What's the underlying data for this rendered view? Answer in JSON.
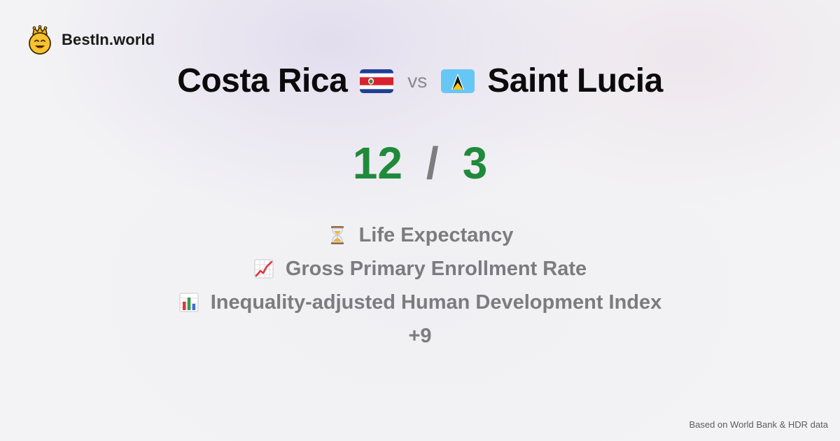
{
  "brand": {
    "name": "BestIn.world",
    "logo_icon": "crown-smiley-icon"
  },
  "comparison": {
    "country_a": {
      "name": "Costa Rica",
      "flag_icon": "costa-rica-flag-icon"
    },
    "vs_label": "vs",
    "country_b": {
      "name": "Saint Lucia",
      "flag_icon": "saint-lucia-flag-icon"
    }
  },
  "score": {
    "a": "12",
    "separator": "/",
    "b": "3",
    "color": "#1f8a3b"
  },
  "metrics": [
    {
      "icon": "hourglass-icon",
      "label": "Life Expectancy"
    },
    {
      "icon": "chart-increasing-icon",
      "label": "Gross Primary Enrollment Rate"
    },
    {
      "icon": "bar-chart-icon",
      "label": "Inequality-adjusted Human Development Index"
    }
  ],
  "more_label": "+9",
  "footer": {
    "source": "Based on World Bank & HDR data"
  }
}
